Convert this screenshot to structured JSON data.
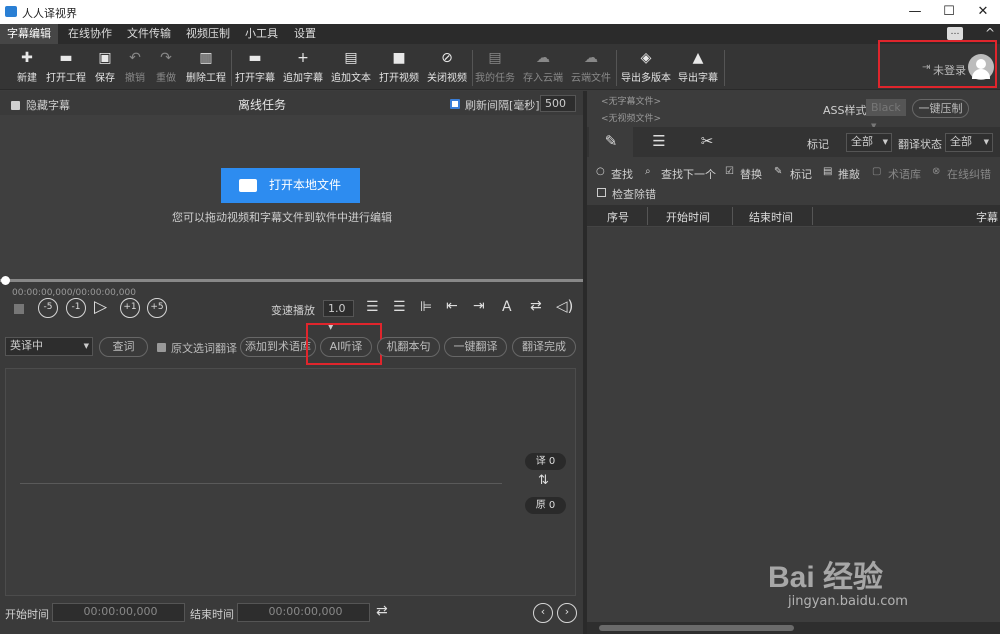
{
  "window": {
    "title": "人人译视界",
    "minimize": "—",
    "maximize": "☐",
    "close": "✕"
  },
  "menu": [
    "字幕编辑",
    "在线协作",
    "文件传输",
    "视频压制",
    "小工具",
    "设置"
  ],
  "toolbar": {
    "items": [
      {
        "label": "新建",
        "icon": "new-file-icon",
        "glyph": "✚"
      },
      {
        "label": "打开工程",
        "icon": "folder-icon",
        "glyph": "▬"
      },
      {
        "label": "保存",
        "icon": "save-icon",
        "glyph": "▣"
      },
      {
        "label": "撤销",
        "icon": "undo-icon",
        "glyph": "↶"
      },
      {
        "label": "重做",
        "icon": "redo-icon",
        "glyph": "↷"
      },
      {
        "label": "删除工程",
        "icon": "trash-icon",
        "glyph": "▥"
      },
      {
        "label": "打开字幕",
        "icon": "open-subtitle-icon",
        "glyph": "▬"
      },
      {
        "label": "追加字幕",
        "icon": "plus-icon",
        "glyph": "+"
      },
      {
        "label": "追加文本",
        "icon": "text-file-icon",
        "glyph": "▤"
      },
      {
        "label": "打开视频",
        "icon": "video-camera-icon",
        "glyph": "■"
      },
      {
        "label": "关闭视频",
        "icon": "video-off-icon",
        "glyph": "⊘"
      },
      {
        "label": "我的任务",
        "icon": "clipboard-icon",
        "glyph": "▤"
      },
      {
        "label": "存入云端",
        "icon": "cloud-icon",
        "glyph": "☁"
      },
      {
        "label": "云端文件",
        "icon": "cloud-upload-icon",
        "glyph": "☁"
      },
      {
        "label": "导出多版本",
        "icon": "layers-icon",
        "glyph": "◈"
      },
      {
        "label": "导出字幕",
        "icon": "export-icon",
        "glyph": "▲"
      }
    ],
    "login": "未登录",
    "collapse": "^",
    "chat": "…"
  },
  "offline": {
    "hide_subtitle": "隐藏字幕",
    "title": "离线任务",
    "refresh_label": "刷新间隔[毫秒]",
    "refresh_value": "500",
    "open_local": "打开本地文件",
    "drag_hint": "您可以拖动视频和字幕文件到软件中进行编辑"
  },
  "player": {
    "time": "00:00:00,000/00:00:00,000",
    "progress": 0,
    "speed_label": "变速播放",
    "speed_value": "1.0"
  },
  "translate": {
    "lang": "英译中",
    "query": "查词",
    "orig_select": "原文选词翻译",
    "add_glossary": "添加到术语库",
    "ai_listen": "AI听译",
    "machine": "机翻本句",
    "one_click": "一键翻译",
    "done": "翻译完成",
    "trans_count": "译 0",
    "orig_count": "原 0",
    "start_label": "开始时间",
    "start_value": "00:00:00,000",
    "end_label": "结束时间",
    "end_value": "00:00:00,000"
  },
  "right": {
    "no_subtitle": "<无字幕文件>",
    "no_video": "<无视频文件>",
    "ass_label": "ASS样式",
    "ass_value": "Black",
    "compress": "一键压制",
    "mark_label": "标记",
    "mark_value": "全部",
    "status_label": "翻译状态",
    "status_value": "全部",
    "actions": [
      "查找",
      "查找下一个",
      "替换",
      "标记",
      "推敲",
      "术语库",
      "在线纠错"
    ],
    "check": "检查除错",
    "columns": [
      "序号",
      "开始时间",
      "结束时间",
      "字幕"
    ]
  },
  "watermark": {
    "brand": "Bai 经验",
    "url": "jingyan.baidu.com"
  },
  "colors": {
    "accent": "#2d8cf0",
    "highlight": "#e0252c"
  }
}
